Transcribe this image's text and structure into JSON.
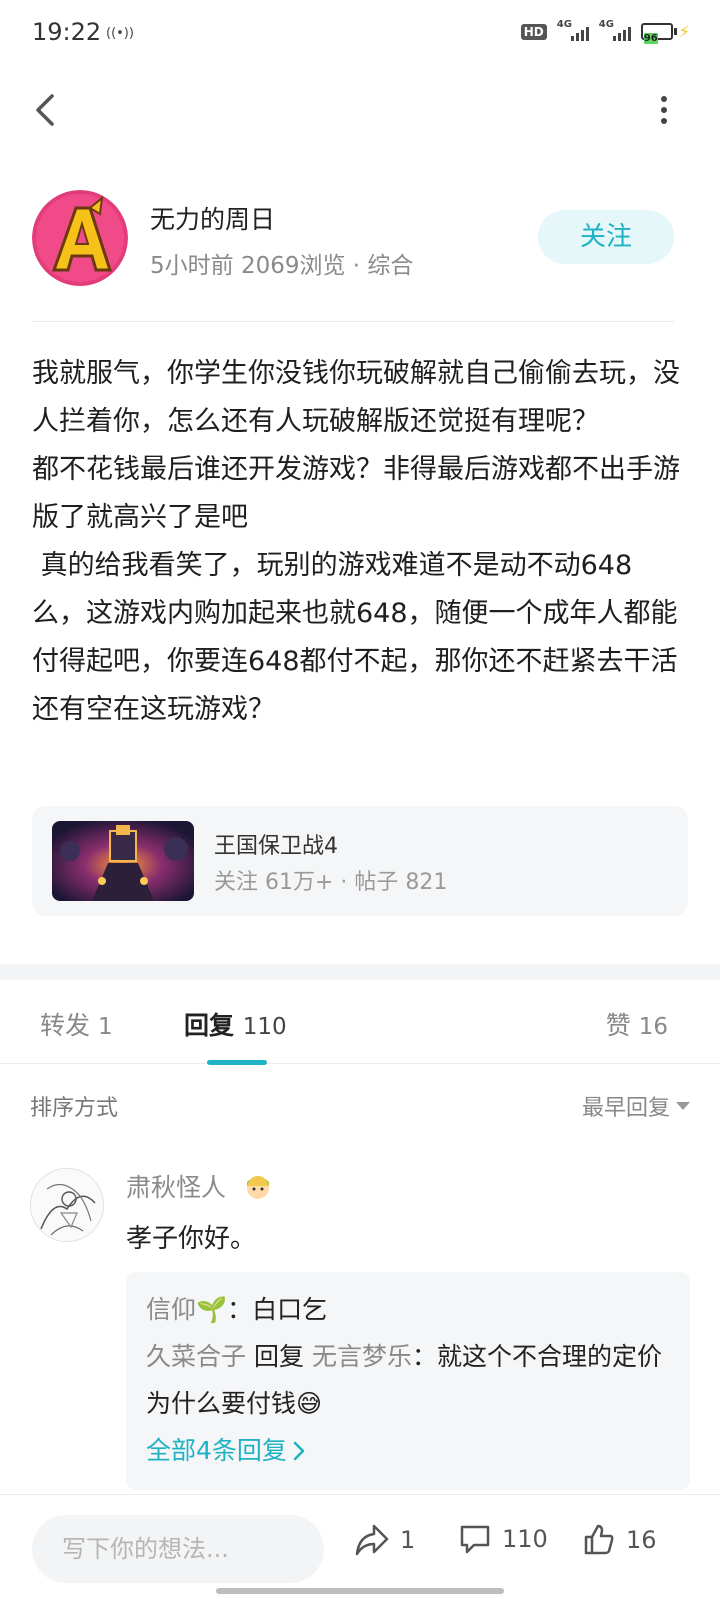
{
  "status_bar": {
    "time": "19:22",
    "radio_icon": "((•))",
    "hd_label": "HD",
    "network_1": "4G",
    "network_2": "4G",
    "battery": "96"
  },
  "author": {
    "name": "无力的周日",
    "meta": "5小时前 2069浏览 · 综合",
    "follow_label": "关注"
  },
  "post": {
    "paragraphs": [
      "我就服气，你学生你没钱你玩破解就自己偷偷去玩，没人拦着你，怎么还有人玩破解版还觉挺有理呢？",
      "都不花钱最后谁还开发游戏？非得最后游戏都不出手游版了就高兴了是吧",
      " 真的给我看笑了，玩别的游戏难道不是动不动648么，这游戏内购加起来也就648，随便一个成年人都能付得起吧，你要连648都付不起，那你还不赶紧去干活还有空在这玩游戏？"
    ]
  },
  "game_card": {
    "name": "王国保卫战4",
    "stats": "关注 61万+ · 帖子 821"
  },
  "tabs": {
    "repost_label": "转发",
    "repost_count": "1",
    "reply_label": "回复",
    "reply_count": "110",
    "like_label": "赞",
    "like_count": "16"
  },
  "sort": {
    "label": "排序方式",
    "value": "最早回复"
  },
  "comment": {
    "user": "肃秋怪人",
    "text": "孝子你好。",
    "replies": [
      {
        "name": "信仰",
        "text": "白口乞"
      },
      {
        "name": "久菜合子",
        "reply_word": "回复",
        "target": "无言梦乐",
        "text": "就这个不合理的定价为什么要付钱😅"
      }
    ],
    "more_label": "全部4条回复"
  },
  "bottom_bar": {
    "input_placeholder": "写下你的想法...",
    "share_count": "1",
    "comment_count": "110",
    "like_count": "16"
  },
  "colors": {
    "accent": "#1fb2c4",
    "follow_bg": "#e5f7f9",
    "muted_text": "#8a8a8a",
    "card_bg": "#f5f6f7"
  },
  "icons": {
    "back": "chevron-left-icon",
    "more": "more-vertical-icon",
    "share": "share-arrow-icon",
    "comment": "comment-bubble-icon",
    "like": "thumbs-up-icon",
    "sort": "caret-down-icon",
    "more_replies": "chevron-right-icon"
  }
}
